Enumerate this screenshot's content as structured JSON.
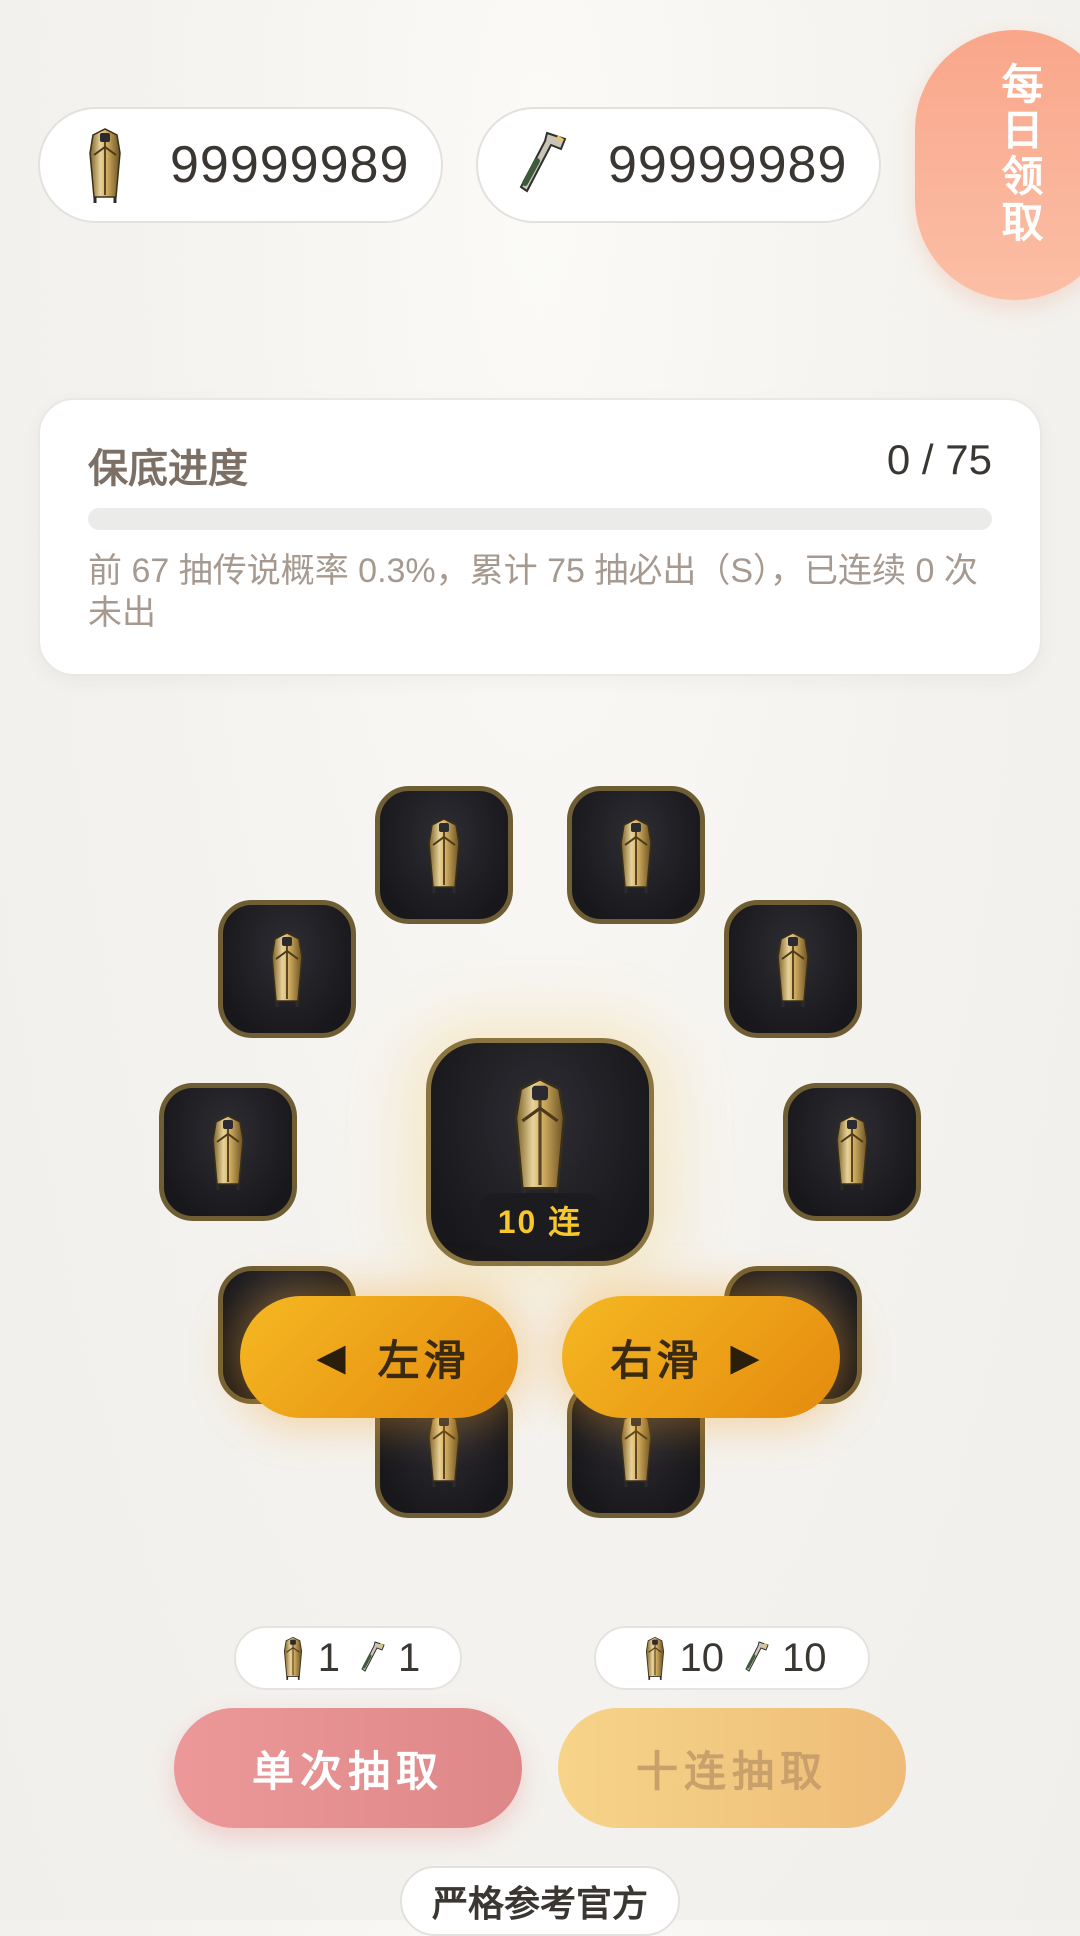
{
  "currency": {
    "keys": {
      "icon": "trophy-key-icon",
      "value": "99999989"
    },
    "tools": {
      "icon": "crowbar-icon",
      "value": "99999989"
    }
  },
  "daily_claim": {
    "label": "每日领取"
  },
  "pity": {
    "title": "保底进度",
    "count_text": "0 / 75",
    "progress": 0,
    "description": "前 67 抽传说概率 0.3%，累计 75 抽必出（S），已连续 0 次未出"
  },
  "wheel": {
    "center_badge": "10 连",
    "item_icon": "golden-case-icon",
    "slot_count": 12
  },
  "controls": {
    "left_label": "左滑",
    "right_label": "右滑",
    "left_arrow_icon": "arrow-left-icon",
    "right_arrow_icon": "arrow-right-icon"
  },
  "draw": {
    "single": {
      "label": "单次抽取",
      "cost_keys": "1",
      "cost_tools": "1"
    },
    "ten": {
      "label": "十连抽取",
      "cost_keys": "10",
      "cost_tools": "10"
    }
  },
  "footer": {
    "label": "严格参考官方"
  },
  "colors": {
    "accent_gold": "#f5b822",
    "single_button": "#ec9899",
    "ten_button": "#f6d489",
    "daily_button": "#f9a68a",
    "badge_text": "#f8c72c"
  }
}
